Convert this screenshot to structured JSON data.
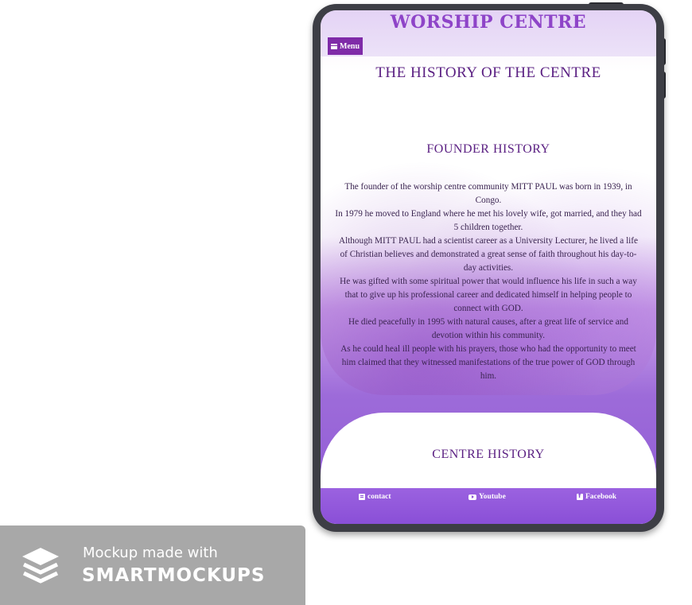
{
  "site": {
    "title": "WORSHIP CENTRE",
    "menu_label": "Menu"
  },
  "page": {
    "heading": "THE HISTORY OF THE CENTRE"
  },
  "founder": {
    "title": "FOUNDER HISTORY",
    "paragraphs": [
      "The founder of the worship centre community MITT PAUL was born in 1939, in Congo.",
      "In 1979 he moved to England where he met his lovely wife, got married, and they had 5 children together.",
      "Although MITT PAUL had a scientist career as a University Lecturer, he lived a life of Christian believes and demonstrated a great sense of faith throughout his day-to-day activities.",
      "He was gifted with some spiritual power that would influence his life in such a way that to give up his professional career and dedicated himself in helping people to connect with GOD.",
      "He died peacefully in 1995 with natural causes, after a great life of service and devotion within his community.",
      "As he could heal ill people with his prayers, those who had the opportunity to meet him claimed that they witnessed manifestations of the true power of GOD through him."
    ]
  },
  "centre": {
    "title": "CENTRE HISTORY"
  },
  "footer": {
    "contact": "contact",
    "youtube": "Youtube",
    "facebook": "Facebook"
  },
  "icons": {
    "menu": "hamburger-icon",
    "contact": "contact-card-icon",
    "youtube": "youtube-icon",
    "facebook": "facebook-icon",
    "badge": "layers-icon"
  },
  "colors": {
    "brand_purple": "#8e44c8",
    "menu_bg": "#7f2ba8",
    "footer_bg": "#8a4fd7"
  },
  "watermark": {
    "line1": "Mockup made with",
    "line2": "SMARTMOCKUPS"
  }
}
